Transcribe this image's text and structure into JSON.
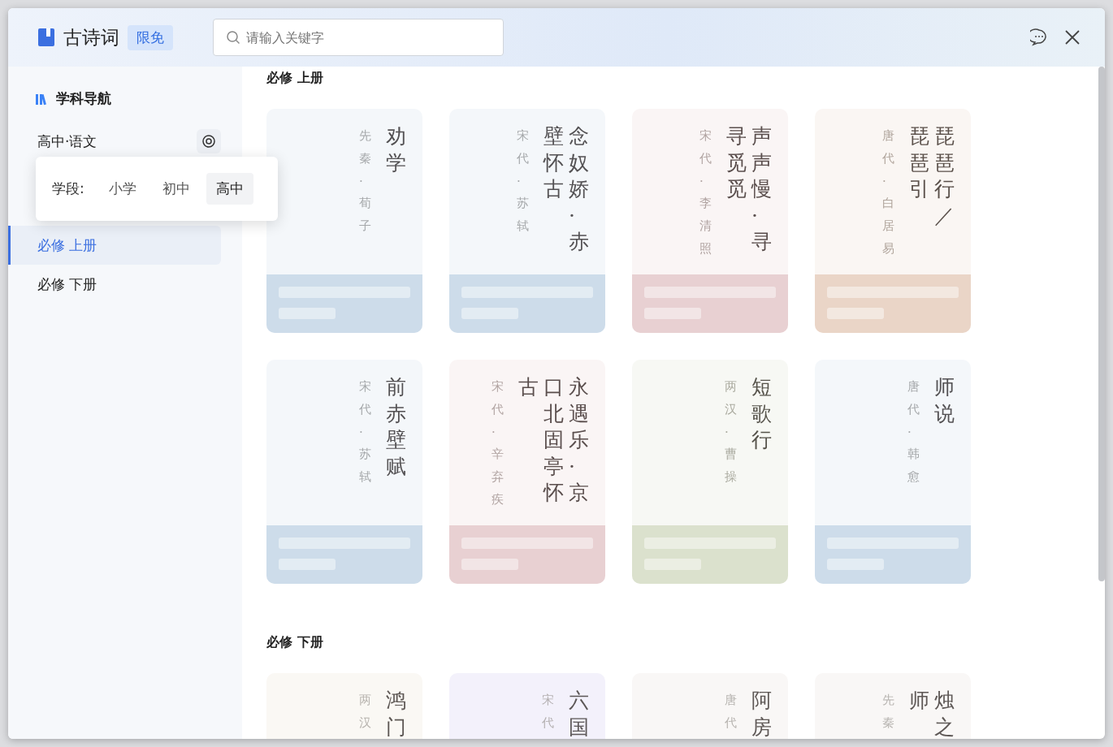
{
  "header": {
    "app_title": "古诗词",
    "badge": "限免",
    "search": {
      "placeholder": "请输入关键字"
    }
  },
  "sidebar": {
    "title": "学科导航",
    "subject": "高中·语文",
    "stage_popup": {
      "label": "学段:",
      "options": [
        {
          "label": "小学",
          "selected": false
        },
        {
          "label": "初中",
          "selected": false
        },
        {
          "label": "高中",
          "selected": true
        }
      ]
    },
    "items": [
      {
        "label": "必修 上册",
        "selected": true
      },
      {
        "label": "必修 下册",
        "selected": false
      }
    ]
  },
  "sections": [
    {
      "title": "必修 上册",
      "cards": [
        {
          "kind": "full",
          "title_columns": [
            "劝学"
          ],
          "author": "先秦·荀子",
          "color": "#cddcea"
        },
        {
          "kind": "full",
          "title_columns": [
            "壁怀古",
            "念奴娇·赤"
          ],
          "author": "宋代·苏轼",
          "color": "#cddcea"
        },
        {
          "kind": "full",
          "title_columns": [
            "寻觅觅",
            "声声慢·寻"
          ],
          "author": "宋代·李清照",
          "color": "#e8d0d2"
        },
        {
          "kind": "full",
          "title_columns": [
            "琵琶引",
            "琵琶行／"
          ],
          "author": "唐代·白居易",
          "color": "#ead5c7"
        },
        {
          "kind": "full",
          "title_columns": [
            "前赤壁赋"
          ],
          "author": "宋代·苏轼",
          "color": "#cddcea"
        },
        {
          "kind": "full",
          "title_columns": [
            "古",
            "口北固亭怀",
            "永遇乐·京"
          ],
          "author": "宋代·辛弃疾",
          "color": "#e8d0d2"
        },
        {
          "kind": "full",
          "title_columns": [
            "短歌行"
          ],
          "author": "两汉·曹操",
          "color": "#dbe1cd"
        },
        {
          "kind": "full",
          "title_columns": [
            "师说"
          ],
          "author": "唐代·韩愈",
          "color": "#cddcea"
        }
      ]
    },
    {
      "title": "必修 下册",
      "cards": [
        {
          "kind": "cut",
          "title_columns": [
            "鸿门"
          ],
          "author": "两汉",
          "color": "#faf8f4"
        },
        {
          "kind": "cut",
          "title_columns": [
            "六国"
          ],
          "author": "宋代",
          "color": "#f3f1fb"
        },
        {
          "kind": "cut",
          "title_columns": [
            "阿房"
          ],
          "author": "唐代",
          "color": "#f9f7f6"
        },
        {
          "kind": "cut",
          "title_columns": [
            "师",
            "烛之"
          ],
          "author": "先秦",
          "color": "#f9f7f6"
        }
      ]
    }
  ]
}
